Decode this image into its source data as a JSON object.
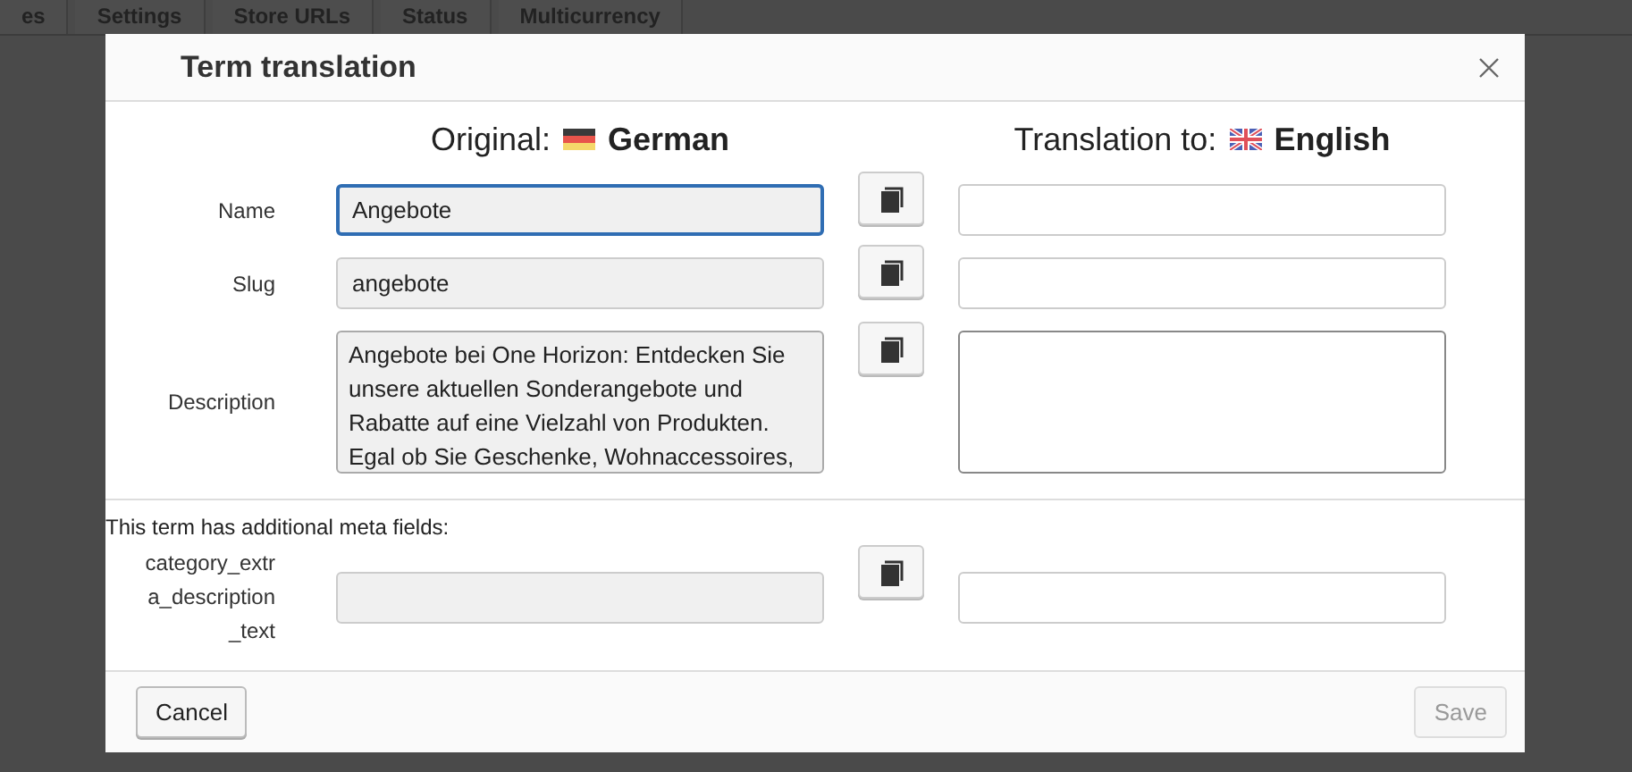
{
  "background_tabs": [
    {
      "label": "es"
    },
    {
      "label": "Settings"
    },
    {
      "label": "Store URLs"
    },
    {
      "label": "Status"
    },
    {
      "label": "Multicurrency"
    }
  ],
  "dialog": {
    "title": "Term translation",
    "original": {
      "label": "Original:",
      "language": "German"
    },
    "translation": {
      "label": "Translation to:",
      "language": "English"
    },
    "rows": [
      {
        "kind": "input",
        "label": "Name",
        "value": "Angebote",
        "focused": true,
        "translation": ""
      },
      {
        "kind": "input",
        "label": "Slug",
        "value": "angebote",
        "focused": false,
        "translation": ""
      },
      {
        "kind": "textarea",
        "label": "Description",
        "value": "Angebote bei One Horizon: Entdecken Sie\nunsere aktuellen Sonderangebote und\nRabatte auf eine Vielzahl von Produkten.\nEgal ob Sie Geschenke, Wohnaccessoires,",
        "focused": false,
        "translation": ""
      }
    ],
    "meta_note": "This term has additional meta fields:",
    "meta_rows": [
      {
        "label": "category_extr\na_description\n_text",
        "value": "",
        "translation": ""
      }
    ],
    "buttons": [
      {
        "label": "Cancel",
        "disabled": false
      },
      {
        "label": "Save",
        "disabled": true
      }
    ]
  }
}
